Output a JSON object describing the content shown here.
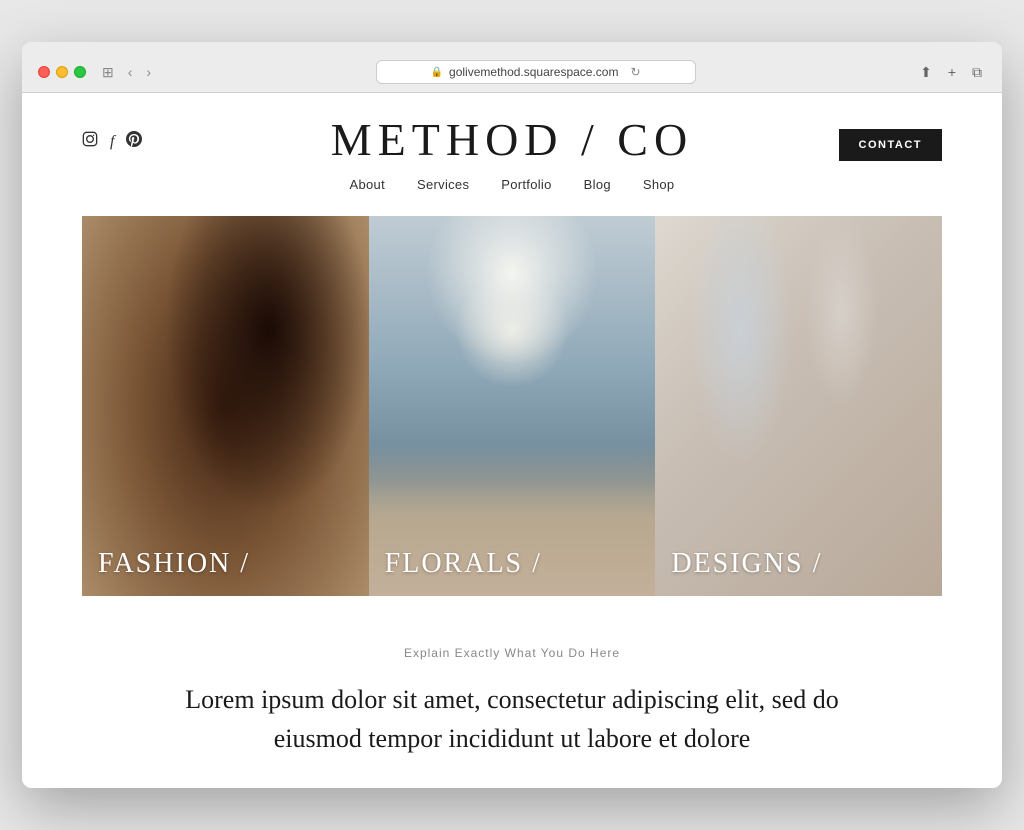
{
  "browser": {
    "url": "golivemethod.squarespace.com",
    "nav_back": "‹",
    "nav_forward": "›",
    "window_icon": "⊞",
    "share_icon": "⬆",
    "add_tab_icon": "+",
    "tab_icon": "⧉",
    "refresh_icon": "↻",
    "lock_icon": "🔒"
  },
  "site": {
    "title": "METHOD / CO",
    "contact_button": "CONTACT",
    "nav_items": [
      {
        "label": "About"
      },
      {
        "label": "Services"
      },
      {
        "label": "Portfolio"
      },
      {
        "label": "Blog"
      },
      {
        "label": "Shop"
      }
    ],
    "social_icons": [
      {
        "name": "instagram",
        "symbol": "ⓘ"
      },
      {
        "name": "facebook",
        "symbol": "f"
      },
      {
        "name": "pinterest",
        "symbol": "𝔭"
      }
    ],
    "gallery": [
      {
        "label": "FASHION /",
        "key": "fashion"
      },
      {
        "label": "FLORALS /",
        "key": "florals"
      },
      {
        "label": "DESIGNS /",
        "key": "designs"
      }
    ],
    "tagline": "Explain Exactly What You Do Here",
    "body_text": "Lorem ipsum dolor sit amet, consectetur adipiscing elit, sed do eiusmod tempor incididunt ut labore et dolore"
  }
}
